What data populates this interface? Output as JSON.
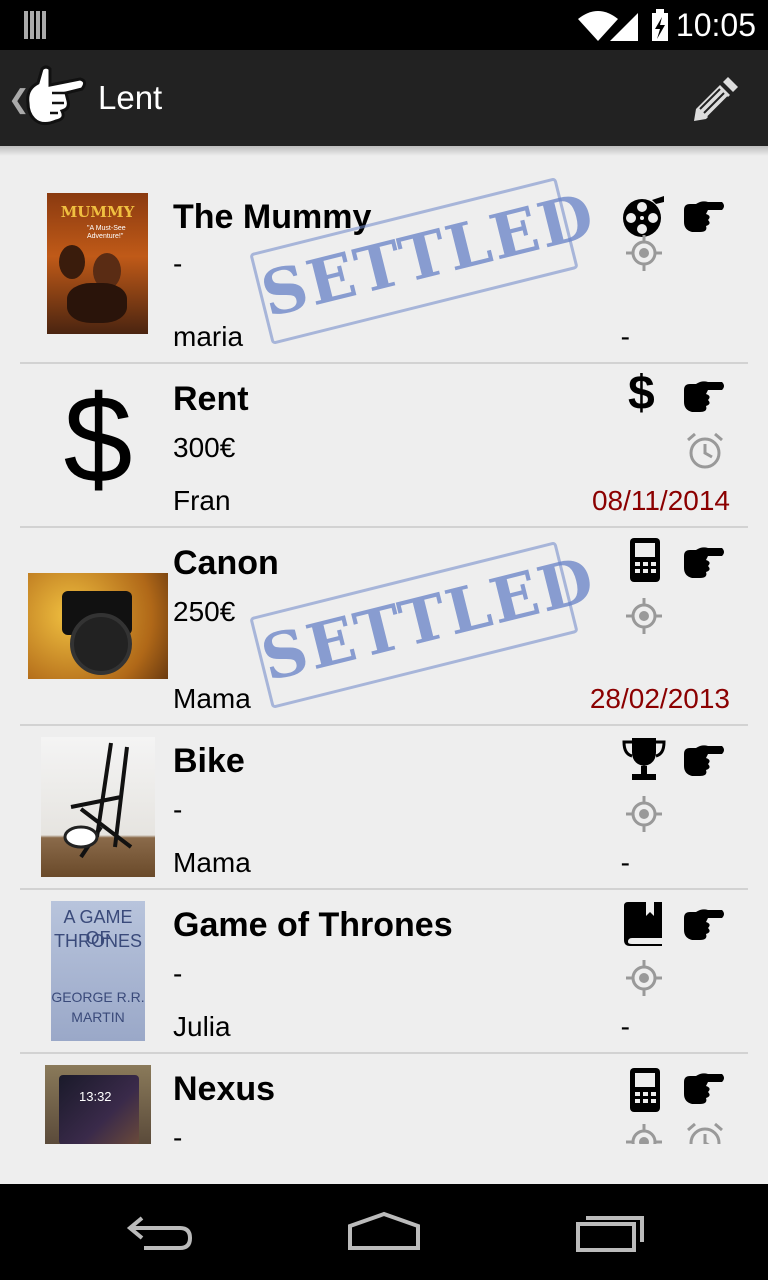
{
  "status_bar": {
    "time": "10:05"
  },
  "header": {
    "title": "Lent"
  },
  "items": [
    {
      "name": "The Mummy",
      "amount": "-",
      "person": "maria",
      "date": "-",
      "settled": true,
      "category_icon": "film-reel-icon",
      "reminder_icon": "location-target-icon"
    },
    {
      "name": "Rent",
      "amount": "300€",
      "person": "Fran",
      "date": "08/11/2014",
      "settled": false,
      "category_icon": "dollar-icon",
      "reminder_icon": "alarm-clock-icon"
    },
    {
      "name": "Canon",
      "amount": "250€",
      "person": "Mama",
      "date": "28/02/2013",
      "settled": true,
      "category_icon": "phone-device-icon",
      "reminder_icon": "location-target-icon"
    },
    {
      "name": "Bike",
      "amount": "-",
      "person": "Mama",
      "date": "-",
      "settled": false,
      "category_icon": "trophy-icon",
      "reminder_icon": "location-target-icon"
    },
    {
      "name": "Game of Thrones",
      "amount": "-",
      "person": "Julia",
      "date": "-",
      "settled": false,
      "category_icon": "book-icon",
      "reminder_icon": "location-target-icon"
    },
    {
      "name": "Nexus",
      "amount": "-",
      "person": "",
      "date": "",
      "settled": false,
      "category_icon": "phone-device-icon",
      "reminder_icon": "location-target-icon"
    }
  ],
  "stamp_text": "SETTLED",
  "thumbnails": {
    "mummy": {
      "title": "MUMMY",
      "subtitle": "\"A Must-See Adventure!\""
    },
    "got": {
      "line1": "A GAME OF",
      "line2": "THRONES",
      "line3": "GEORGE R.R.",
      "line4": "MARTIN"
    },
    "nexus": {
      "clock": "13:32"
    },
    "rent_symbol": "$"
  },
  "colors": {
    "accent_date": "#8b0000",
    "stamp": "#6e87c8",
    "header_bg": "#222222",
    "list_bg": "#eeeeee"
  }
}
